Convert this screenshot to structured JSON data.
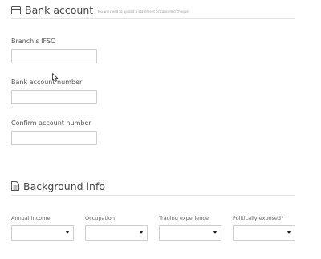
{
  "bank": {
    "title": "Bank account",
    "note": "You will need to upload a statement or cancelled cheque",
    "icon": "credit-card-icon",
    "fields": [
      {
        "label": "Branch's IFSC",
        "value": ""
      },
      {
        "label": "Bank account number",
        "value": ""
      },
      {
        "label": "Confirm account number",
        "value": ""
      }
    ]
  },
  "background": {
    "title": "Background info",
    "icon": "document-icon",
    "selects": [
      {
        "label": "Annual income",
        "value": ""
      },
      {
        "label": "Occupation",
        "value": ""
      },
      {
        "label": "Trading experience",
        "value": ""
      },
      {
        "label": "Politically exposed?",
        "value": ""
      }
    ]
  }
}
